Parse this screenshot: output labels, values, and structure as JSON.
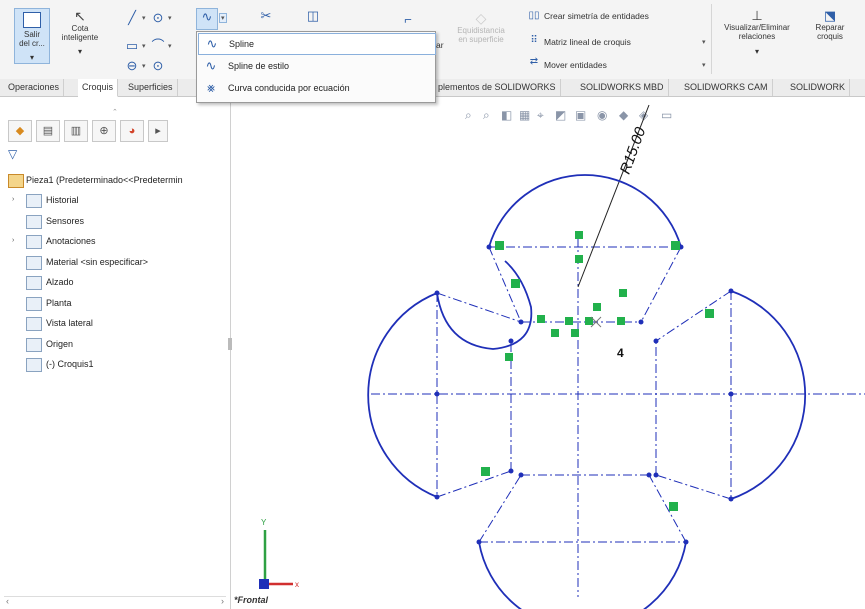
{
  "ribbon": {
    "exit_label_1": "Salir",
    "exit_label_2": "del cr...",
    "smart_dim_label_1": "Cota",
    "smart_dim_label_2": "inteligente",
    "equidistance_label_1": "Equidistancia",
    "equidistance_label_2": "en superficie",
    "mirror_label": "Crear simetría de entidades",
    "linear_pattern_label": "Matriz lineal de croquis",
    "move_label": "Mover entidades",
    "relations_label_1": "Visualizar/Eliminar",
    "relations_label_2": "relaciones",
    "repair_label_1": "Reparar",
    "repair_label_2": "croquis",
    "partial_letter": "ar"
  },
  "tabs": [
    {
      "label": "Operaciones",
      "active": false
    },
    {
      "label": "Croquis",
      "active": true
    },
    {
      "label": "Superficies",
      "active": false
    },
    {
      "label": "plementos de SOLIDWORKS",
      "active": false
    },
    {
      "label": "SOLIDWORKS MBD",
      "active": false
    },
    {
      "label": "SOLIDWORKS CAM",
      "active": false
    },
    {
      "label": "SOLIDWORK",
      "active": false
    }
  ],
  "dropdown": {
    "items": [
      {
        "label": "Spline",
        "icon": "spline-icon"
      },
      {
        "label": "Spline de estilo",
        "icon": "style-spline-icon"
      },
      {
        "label": "Curva conducida por ecuación",
        "icon": "equation-curve-icon"
      }
    ]
  },
  "tree": {
    "root": "Pieza1  (Predeterminado<<Predetermin",
    "items": [
      {
        "label": "Historial",
        "expand": true
      },
      {
        "label": "Sensores",
        "expand": false
      },
      {
        "label": "Anotaciones",
        "expand": true
      },
      {
        "label": "Material <sin especificar>",
        "expand": false
      },
      {
        "label": "Alzado",
        "expand": false
      },
      {
        "label": "Planta",
        "expand": false
      },
      {
        "label": "Vista lateral",
        "expand": false
      },
      {
        "label": "Origen",
        "expand": false
      },
      {
        "label": "(-) Croquis1",
        "expand": false
      }
    ]
  },
  "canvas": {
    "dimension_label": "R15.00",
    "count_label": "4",
    "view_label": "*Frontal",
    "axis_x": "x",
    "axis_y": "Y",
    "sketch_color": "#1f2fb8",
    "relation_color": "#22b14c"
  }
}
